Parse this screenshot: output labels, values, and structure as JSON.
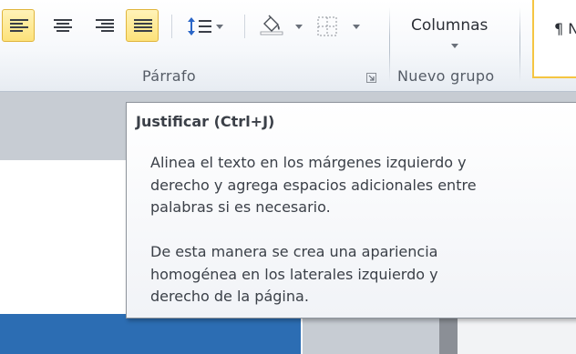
{
  "ribbon": {
    "paragraph_group_label": "Párrafo",
    "nuevo_grupo_label": "Nuevo grupo",
    "columns_label": "Columnas",
    "style_label": "¶ N",
    "buttons": {
      "align_left": {
        "icon": "align-left-icon",
        "active": true
      },
      "align_center": {
        "icon": "align-center-icon",
        "active": false
      },
      "align_right": {
        "icon": "align-right-icon",
        "active": false
      },
      "justify": {
        "icon": "justify-icon",
        "active": true
      },
      "line_spacing": {
        "icon": "line-spacing-icon"
      },
      "shading": {
        "icon": "paint-bucket-icon"
      },
      "borders": {
        "icon": "borders-icon"
      }
    },
    "colors": {
      "active_bg": "#fde27a",
      "active_border": "#e0b53d",
      "line_spacing_accent": "#2a66c7"
    }
  },
  "tooltip": {
    "title": "Justificar (Ctrl+J)",
    "paragraph1": [
      "Alinea el texto en los márgenes izquierdo y",
      "derecho y agrega espacios adicionales entre",
      "palabras si es necesario."
    ],
    "paragraph2": [
      "De esta manera se crea una apariencia",
      "homogénea en los laterales izquierdo y",
      "derecho de la página."
    ]
  },
  "document": {
    "bar_color": "#2c6db3"
  }
}
